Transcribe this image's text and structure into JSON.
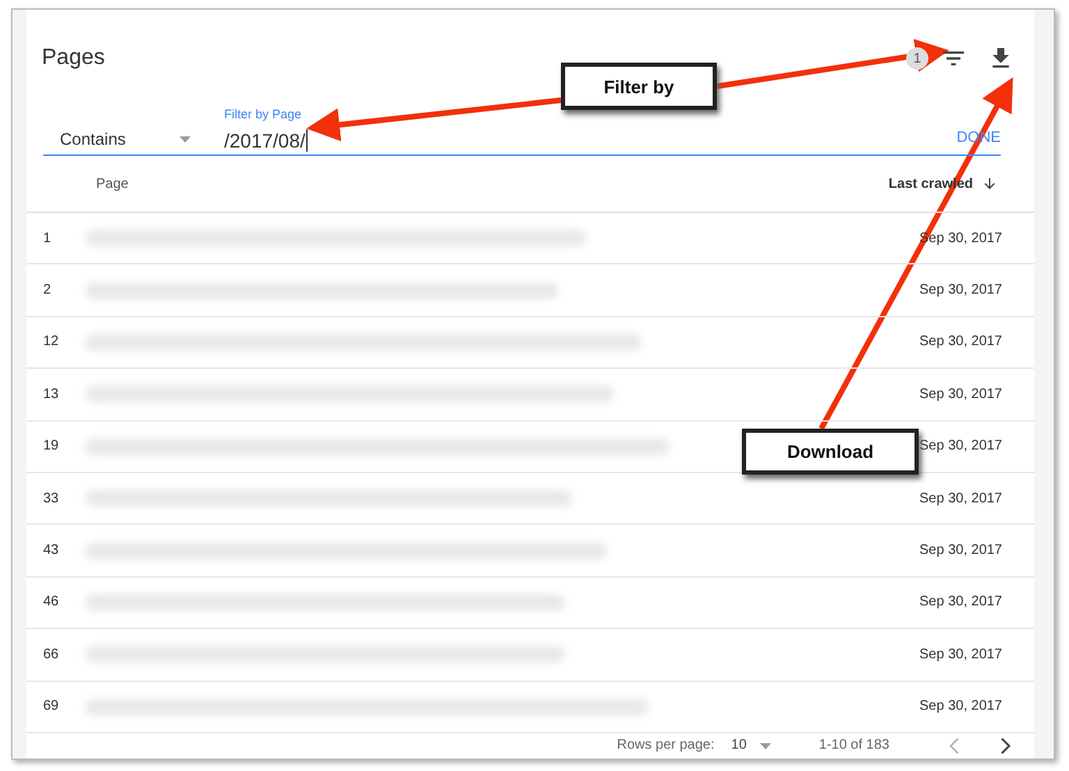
{
  "title": "Pages",
  "toolbar": {
    "filter_count": "1"
  },
  "filter": {
    "operator": "Contains",
    "label": "Filter by Page",
    "value": "/2017/08/",
    "done": "DONE"
  },
  "table": {
    "columns": [
      {
        "label": "Page",
        "sorted": false
      },
      {
        "label": "Last crawled",
        "sorted": true
      }
    ],
    "rows": [
      {
        "index": "1",
        "page": {
          "kind": "redacted"
        },
        "date": "Sep 30, 2017"
      },
      {
        "index": "2",
        "page": {
          "kind": "redacted"
        },
        "date": "Sep 30, 2017"
      },
      {
        "index": "12",
        "page": {
          "kind": "redacted"
        },
        "date": "Sep 30, 2017"
      },
      {
        "index": "13",
        "page": {
          "kind": "redacted"
        },
        "date": "Sep 30, 2017"
      },
      {
        "index": "19",
        "page": {
          "kind": "redacted"
        },
        "date": "Sep 30, 2017"
      },
      {
        "index": "33",
        "page": {
          "kind": "redacted"
        },
        "date": "Sep 30, 2017"
      },
      {
        "index": "43",
        "page": {
          "kind": "redacted"
        },
        "date": "Sep 30, 2017"
      },
      {
        "index": "46",
        "page": {
          "kind": "redacted"
        },
        "date": "Sep 30, 2017"
      },
      {
        "index": "66",
        "page": {
          "kind": "redacted"
        },
        "date": "Sep 30, 2017"
      },
      {
        "index": "69",
        "page": {
          "kind": "redacted"
        },
        "date": "Sep 30, 2017"
      }
    ]
  },
  "pagination": {
    "rows_label": "Rows per page:",
    "rows_value": "10",
    "range": "1-10 of 183"
  },
  "callouts": [
    {
      "kind": "filter",
      "text": "Filter by"
    },
    {
      "kind": "download",
      "text": "Download"
    }
  ]
}
